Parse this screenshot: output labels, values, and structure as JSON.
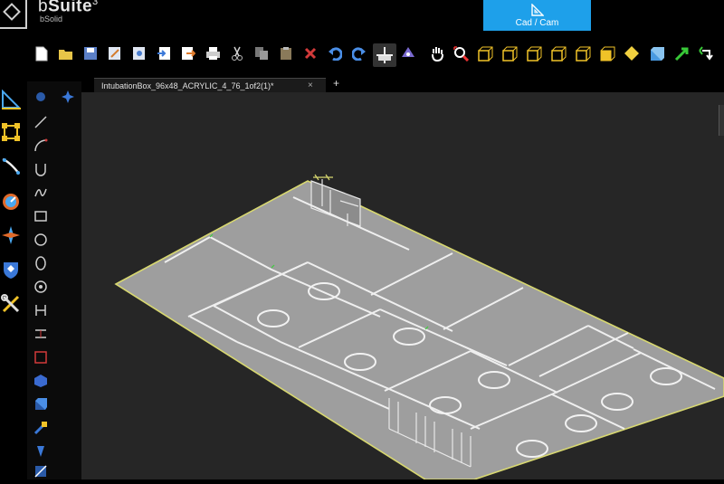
{
  "app": {
    "brand_prefix": "b",
    "brand_main": "Suite",
    "brand_sup": "3",
    "brand_sub": "bSolid"
  },
  "mode_button": {
    "label": "Cad / Cam",
    "icon": "set-square-icon",
    "color": "#1ea0ea"
  },
  "toolbar": {
    "icons": [
      "new-file-icon",
      "open-folder-icon",
      "save-icon",
      "edit-icon",
      "properties-icon",
      "import-icon",
      "export-icon",
      "print-icon",
      "cut-icon",
      "copy-icon",
      "paste-icon",
      "delete-icon",
      "undo-icon",
      "redo-icon",
      "move-icon",
      "snap-icon",
      "pan-hand-icon",
      "zoom-fit-icon",
      "view-cube-1-icon",
      "view-cube-2-icon",
      "view-cube-3-icon",
      "view-cube-4-icon",
      "view-cube-5-icon",
      "view-cube-6-icon",
      "view-iso-icon",
      "view-solid-icon",
      "arrow-green-icon",
      "rotate-icon"
    ]
  },
  "tabs": [
    {
      "label": "IntubationBox_96x48_ACRYLIC_4_76_1of2(1)*",
      "close": "×"
    }
  ],
  "new_tab_label": "+",
  "left_tools": [
    "triangle-tool-icon",
    "select-nodes-icon",
    "path-tool-icon",
    "gauge-icon",
    "compass-icon",
    "shield-icon",
    "wrench-tools-icon"
  ],
  "sketch_tools": [
    "point-icon",
    "line-icon",
    "arc-icon",
    "u-shape-icon",
    "spline-icon",
    "rectangle-icon",
    "circle-icon",
    "ellipse-icon",
    "polygon-icon",
    "dimension-icon",
    "square-icon",
    "cube-icon",
    "box-icon",
    "pick-icon",
    "tool-icon",
    "extra-icon"
  ],
  "colors": {
    "accent": "#1ea0ea",
    "sheet_border": "#d8d870",
    "sheet_fill": "#9a9a9a",
    "viewport_bg": "#262626"
  }
}
